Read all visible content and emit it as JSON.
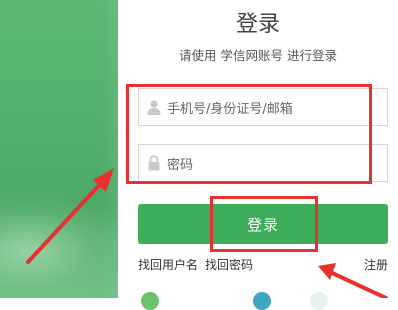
{
  "title": "登录",
  "subtitle": "请使用  学信网账号  进行登录",
  "username_field": {
    "placeholder": "手机号/身份证号/邮箱",
    "icon": "user-icon"
  },
  "password_field": {
    "placeholder": "密码",
    "icon": "lock-icon"
  },
  "login_button": "登录",
  "links": {
    "forgot_username": "找回用户名",
    "forgot_password": "找回密码",
    "register": "注册"
  },
  "colors": {
    "brand_green": "#3fae5b",
    "side_panel": "#51b06b",
    "annotation_red": "#e8312e"
  }
}
